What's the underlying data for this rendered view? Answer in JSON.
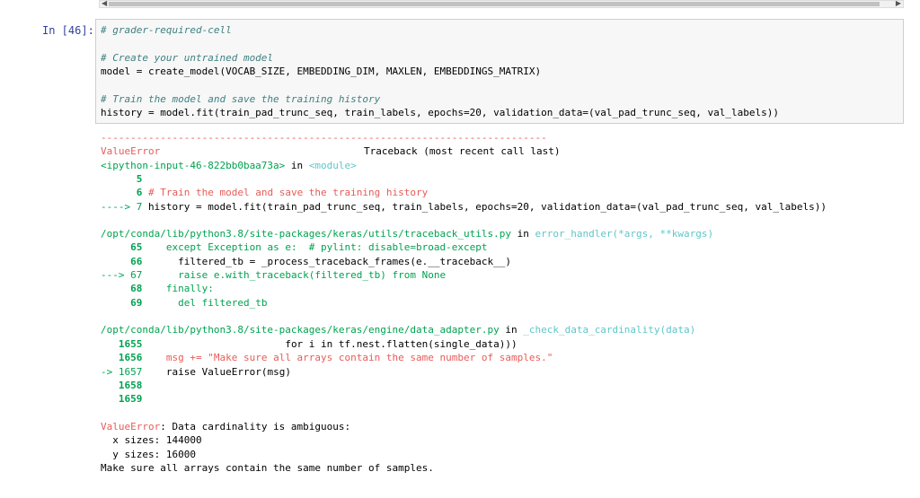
{
  "scrollbar": {
    "left_arrow": "◀",
    "right_arrow": "▶"
  },
  "cell": {
    "prompt": "In [46]:",
    "code": [
      {
        "text": "# grader-required-cell",
        "kind": "comment"
      },
      {
        "text": "",
        "kind": "blank"
      },
      {
        "text": "# Create your untrained model",
        "kind": "comment"
      },
      {
        "text": "model = create_model(VOCAB_SIZE, EMBEDDING_DIM, MAXLEN, EMBEDDINGS_MATRIX)",
        "kind": "code"
      },
      {
        "text": "",
        "kind": "blank"
      },
      {
        "text": "# Train the model and save the training history",
        "kind": "comment"
      },
      {
        "text": "history = model.fit(train_pad_trunc_seq, train_labels, epochs=20, validation_data=(val_pad_trunc_seq, val_labels))",
        "kind": "code"
      }
    ]
  },
  "output": {
    "separator": "---------------------------------------------------------------------------",
    "error_name": "ValueError",
    "traceback_header": "Traceback (most recent call last)",
    "input_ref": "<ipython-input-46-822bb0baa73a>",
    "in_word": " in ",
    "module": "<module>",
    "frame1": [
      {
        "marker": "      ",
        "lineno": "5",
        "code": ""
      },
      {
        "marker": "      ",
        "lineno": "6",
        "code": "# Train the model and save the training history"
      },
      {
        "marker": "----> ",
        "lineno": "7",
        "code": "history = model.fit(train_pad_trunc_seq, train_labels, epochs=20, validation_data=(val_pad_trunc_seq, val_labels))"
      }
    ],
    "file2": "/opt/conda/lib/python3.8/site-packages/keras/utils/traceback_utils.py",
    "func2": "error_handler(*args, **kwargs)",
    "frame2": [
      {
        "marker": "     ",
        "lineno": "65",
        "code": "    except Exception as e:  # pylint: disable=broad-except"
      },
      {
        "marker": "     ",
        "lineno": "66",
        "code": "      filtered_tb = _process_traceback_frames(e.__traceback__)"
      },
      {
        "marker": "---> ",
        "lineno": "67",
        "code": "      raise e.with_traceback(filtered_tb) from None"
      },
      {
        "marker": "     ",
        "lineno": "68",
        "code": "    finally:"
      },
      {
        "marker": "     ",
        "lineno": "69",
        "code": "      del filtered_tb"
      }
    ],
    "file3": "/opt/conda/lib/python3.8/site-packages/keras/engine/data_adapter.py",
    "func3": "_check_data_cardinality(data)",
    "frame3": [
      {
        "marker": "   ",
        "lineno": "1655",
        "code": "                        for i in tf.nest.flatten(single_data)))"
      },
      {
        "marker": "   ",
        "lineno": "1656",
        "code": "    msg += \"Make sure all arrays contain the same number of samples.\""
      },
      {
        "marker": "-> ",
        "lineno": "1657",
        "code": "    raise ValueError(msg)"
      },
      {
        "marker": "   ",
        "lineno": "1658",
        "code": ""
      },
      {
        "marker": "   ",
        "lineno": "1659",
        "code": ""
      }
    ],
    "final_error": "ValueError",
    "final_message": ": Data cardinality is ambiguous:",
    "sizes": [
      "  x sizes: 144000",
      "  y sizes: 16000"
    ],
    "last_line": "Make sure all arrays contain the same number of samples."
  }
}
